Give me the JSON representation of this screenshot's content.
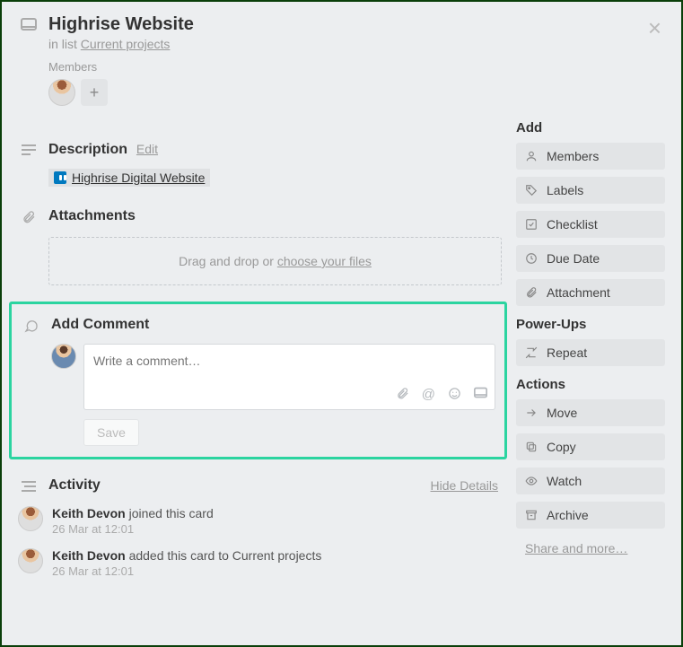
{
  "header": {
    "title": "Highrise Website",
    "in_list_prefix": "in list ",
    "list_name": "Current projects"
  },
  "members": {
    "label": "Members"
  },
  "description": {
    "title": "Description",
    "edit": "Edit",
    "link_text": "Highrise Digital Website"
  },
  "attachments": {
    "title": "Attachments",
    "drop_prefix": "Drag and drop or ",
    "choose": "choose your files"
  },
  "comment": {
    "title": "Add Comment",
    "placeholder": "Write a comment…",
    "save": "Save"
  },
  "activity": {
    "title": "Activity",
    "hide": "Hide Details",
    "items": [
      {
        "actor": "Keith Devon",
        "text": " joined this card",
        "time": "26 Mar at 12:01"
      },
      {
        "actor": "Keith Devon",
        "text": " added this card to Current projects",
        "time": "26 Mar at 12:01"
      }
    ]
  },
  "sidebar": {
    "add_heading": "Add",
    "add": [
      {
        "label": "Members"
      },
      {
        "label": "Labels"
      },
      {
        "label": "Checklist"
      },
      {
        "label": "Due Date"
      },
      {
        "label": "Attachment"
      }
    ],
    "powerups_heading": "Power-Ups",
    "powerups": [
      {
        "label": "Repeat"
      }
    ],
    "actions_heading": "Actions",
    "actions": [
      {
        "label": "Move"
      },
      {
        "label": "Copy"
      },
      {
        "label": "Watch"
      },
      {
        "label": "Archive"
      }
    ],
    "share": "Share and more…"
  }
}
